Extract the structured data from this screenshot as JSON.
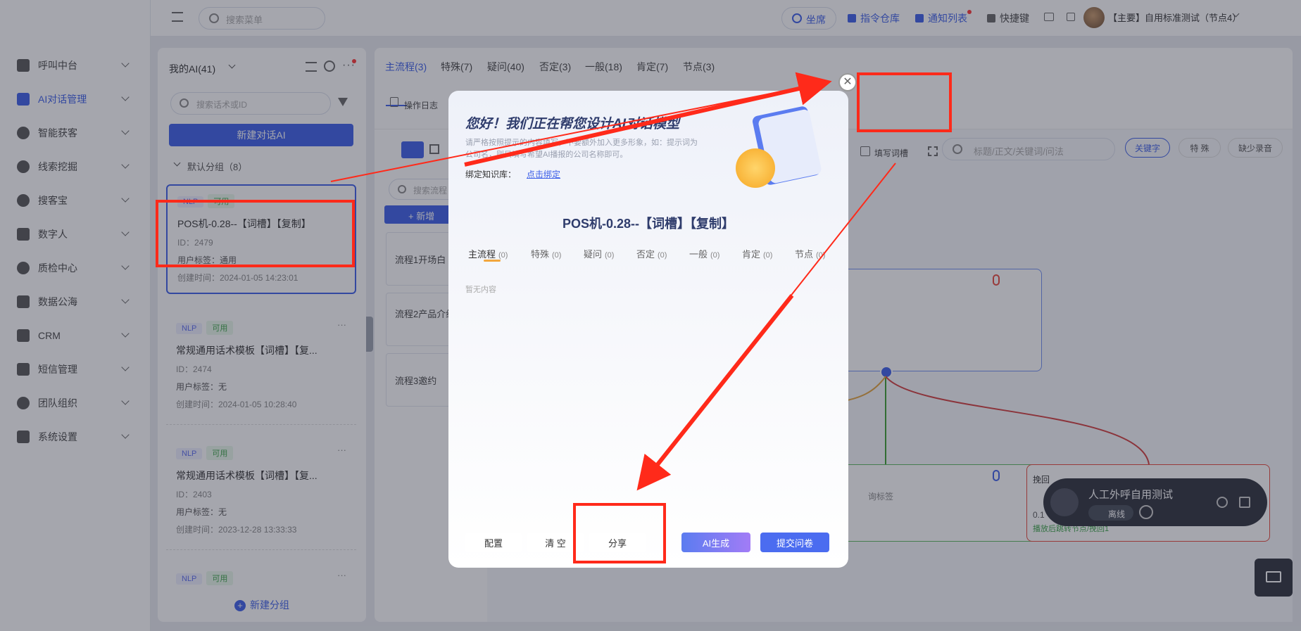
{
  "header": {
    "search_placeholder": "搜索菜单",
    "seat": "坐席",
    "command_repo": "指令仓库",
    "notify_list": "通知列表",
    "shortcut": "快捷键",
    "account": "【主要】自用标准测试（节点4）"
  },
  "sidebar": {
    "items": [
      {
        "label": "呼叫中台"
      },
      {
        "label": "AI对话管理"
      },
      {
        "label": "智能获客"
      },
      {
        "label": "线索挖掘"
      },
      {
        "label": "搜客宝"
      },
      {
        "label": "数字人"
      },
      {
        "label": "质检中心"
      },
      {
        "label": "数据公海"
      },
      {
        "label": "CRM"
      },
      {
        "label": "短信管理"
      },
      {
        "label": "团队组织"
      },
      {
        "label": "系统设置"
      }
    ]
  },
  "ai_list": {
    "title": "我的AI(41)",
    "search_placeholder": "搜索话术或ID",
    "new_button": "新建对话AI",
    "group": "默认分组（8）",
    "new_group": "新建分组",
    "cards": [
      {
        "tag1": "NLP",
        "tag2": "可用",
        "title": "POS机-0.28--【词槽】【复制】",
        "id": "ID：2479",
        "user_tag": "用户标签：通用",
        "created": "创建时间：2024-01-05 14:23:01"
      },
      {
        "tag1": "NLP",
        "tag2": "可用",
        "title": "常规通用话术模板【词槽】【复...",
        "id": "ID：2474",
        "user_tag": "用户标签：无",
        "created": "创建时间：2024-01-05 10:28:40"
      },
      {
        "tag1": "NLP",
        "tag2": "可用",
        "title": "常规通用话术模板【词槽】【复...",
        "id": "ID：2403",
        "user_tag": "用户标签：无",
        "created": "创建时间：2023-12-28 13:33:33"
      },
      {
        "tag1": "NLP",
        "tag2": "可用"
      }
    ]
  },
  "main": {
    "tabs": [
      "主流程(3)",
      "特殊(7)",
      "疑问(40)",
      "否定(3)",
      "一般(18)",
      "肯定(7)",
      "节点(3)"
    ],
    "op_log": "操作日志",
    "write_script": "填写词槽",
    "search_placeholder": "标题/正文/关键词/问法",
    "filter_keyword": "关键字",
    "filter_special": "特 殊",
    "filter_missing": "缺少录音",
    "flow_search": "搜索流程",
    "add_new": "+ 新增",
    "flows": [
      "流程1开场白",
      "流程2产品介绍",
      "流程3邀约"
    ],
    "node_hangup": "挽回",
    "node_hangup_note": "播放后跳转节点/挽回1",
    "node_partial": "0.1",
    "node_tag_hint": "询标签"
  },
  "call_widget": {
    "name": "人工外呼自用测试",
    "status": "离线"
  },
  "modal": {
    "heading": "您好！我们正在帮您设计AI对话模型",
    "desc": "请严格按照提示的内容填写，不要额外加入更多形象，如：提示词为公司名，则只填写希望AI播报的公司名称即可。",
    "kb_label": "绑定知识库：",
    "kb_link": "点击绑定",
    "model_title": "POS机-0.28--【词槽】【复制】",
    "tabs": [
      {
        "label": "主流程",
        "count": "(0)"
      },
      {
        "label": "特殊",
        "count": "(0)"
      },
      {
        "label": "疑问",
        "count": "(0)"
      },
      {
        "label": "否定",
        "count": "(0)"
      },
      {
        "label": "一般",
        "count": "(0)"
      },
      {
        "label": "肯定",
        "count": "(0)"
      },
      {
        "label": "节点",
        "count": "(0)"
      }
    ],
    "empty": "暂无内容",
    "btn_config": "配置",
    "btn_clear": "清 空",
    "btn_share": "分享",
    "btn_ai": "AI生成",
    "btn_submit": "提交问卷"
  },
  "colors": {
    "accent": "#3b5ee8",
    "annotation": "#ff2a1a"
  }
}
